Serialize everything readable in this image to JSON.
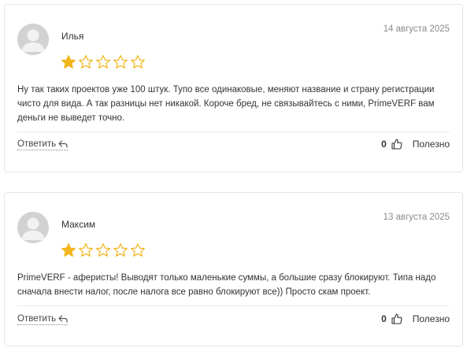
{
  "colors": {
    "star_filled": "#f2b51d",
    "star_empty_stroke": "#f2b51d",
    "avatar_bg": "#d2d2d2",
    "card_border": "#e6e6e6",
    "date_text": "#8a8a8a"
  },
  "reviews": [
    {
      "author": "Илья",
      "date": "14 августа 2025",
      "rating": 1,
      "max_rating": 5,
      "text": "Ну так таких проектов уже 100 штук. Тупо все одинаковые, меняют название и страну регистрации чисто для вида. А так разницы нет никакой. Короче бред, не связывайтесь с ними, PrimeVERF вам деньги не выведет точно.",
      "reply_label": "Ответить",
      "likes": "0",
      "helpful_label": "Полезно",
      "avatar_icon": "user-avatar-icon",
      "reply_icon": "reply-arrow-icon",
      "like_icon": "thumbs-up-icon"
    },
    {
      "author": "Максим",
      "date": "13 августа 2025",
      "rating": 1,
      "max_rating": 5,
      "text": "PrimeVERF - аферисты! Выводят только маленькие суммы, а большие сразу блокируют. Типа надо сначала внести налог, после налога все равно блокируют все)) Просто скам проект.",
      "reply_label": "Ответить",
      "likes": "0",
      "helpful_label": "Полезно",
      "avatar_icon": "user-avatar-icon",
      "reply_icon": "reply-arrow-icon",
      "like_icon": "thumbs-up-icon"
    }
  ]
}
